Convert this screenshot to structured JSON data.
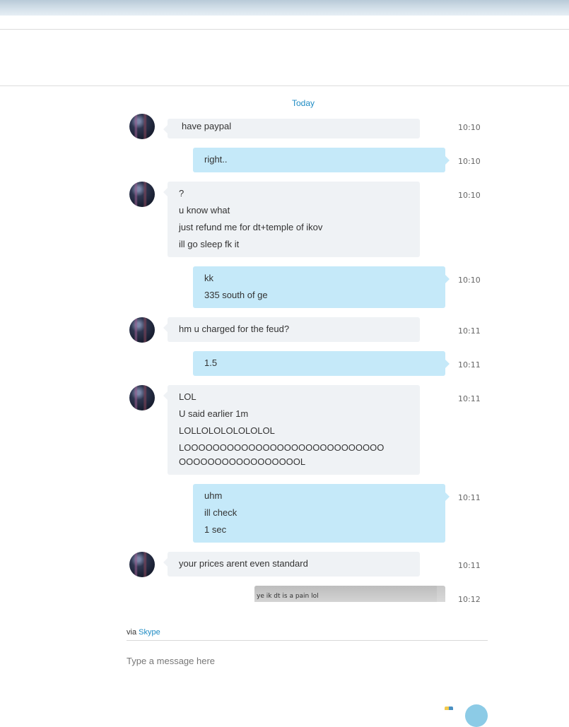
{
  "date_divider": "Today",
  "messages": [
    {
      "from": "them",
      "lines": [
        "have paypal"
      ],
      "time": "10:10"
    },
    {
      "from": "me",
      "lines": [
        "right.."
      ],
      "time": "10:10"
    },
    {
      "from": "them",
      "lines": [
        "?",
        "u know what",
        "just refund me for dt+temple of ikov",
        "ill go sleep fk it"
      ],
      "time": "10:10"
    },
    {
      "from": "me",
      "lines": [
        "kk",
        "335 south of ge"
      ],
      "time": "10:10"
    },
    {
      "from": "them",
      "lines": [
        "hm u charged for the feud?"
      ],
      "time": "10:11"
    },
    {
      "from": "me",
      "lines": [
        "1.5"
      ],
      "time": "10:11"
    },
    {
      "from": "them",
      "lines": [
        "LOL",
        "U said earlier 1m",
        "LOLLOLOLOLOLOLOL",
        "LOOOOOOOOOOOOOOOOOOOOOOOOOOOOOOOOOOOOOOOOOOOOOL"
      ],
      "time": "10:11"
    },
    {
      "from": "me",
      "lines": [
        "uhm",
        "ill check",
        "1 sec"
      ],
      "time": "10:11"
    },
    {
      "from": "them",
      "lines": [
        "your prices arent even standard"
      ],
      "time": "10:11"
    },
    {
      "from": "me",
      "lines": [
        "ye ik dt is a pain lol"
      ],
      "time": "10:12"
    }
  ],
  "footer": {
    "via_prefix": "via",
    "via_link": "Skype",
    "compose_placeholder": "Type a message here"
  }
}
